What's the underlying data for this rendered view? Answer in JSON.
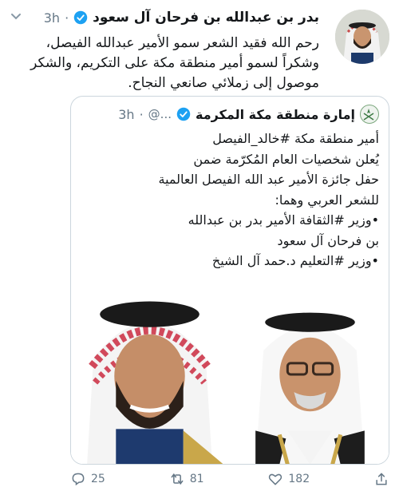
{
  "author": {
    "name": "بدر بن عبدالله بن فرحان آل سعود",
    "time": "3h",
    "avatar_icon": "user-avatar"
  },
  "tweet": {
    "lines": [
      "رحم الله فقيد الشعر سمو الأمير عبدالله الفيصل،",
      "وشكراً لسمو أمير منطقة مكة على التكريم، والشكر",
      "موصول إلى زملائي صانعي النجاح."
    ]
  },
  "quote": {
    "name": "إمارة منطقة مكة المكرمة",
    "handle": "@...",
    "time": "3h",
    "lines": [
      "أمير منطقة مكة #خالد_الفيصل",
      "يُعلن شخصيات العام المُكرّمة ضمن",
      "حفل جائزة الأمير عبد الله الفيصل العالمية",
      "للشعر العربي وهما:",
      "•وزير #الثقافة الأمير بدر بن عبدالله",
      "بن فرحان آل سعود",
      "•وزير #التعليم د.حمد آل الشيخ"
    ]
  },
  "actions": {
    "replies": "25",
    "retweets": "81",
    "likes": "182"
  },
  "colors": {
    "verified": "#1da1f2",
    "muted": "#657786",
    "border": "#ccd6dd"
  }
}
